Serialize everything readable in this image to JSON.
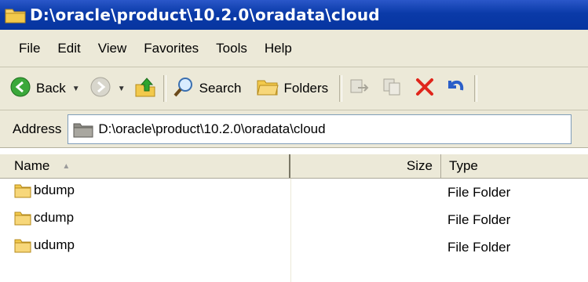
{
  "window": {
    "title": "D:\\oracle\\product\\10.2.0\\oradata\\cloud"
  },
  "menu": {
    "items": [
      {
        "label": "File"
      },
      {
        "label": "Edit"
      },
      {
        "label": "View"
      },
      {
        "label": "Favorites"
      },
      {
        "label": "Tools"
      },
      {
        "label": "Help"
      }
    ]
  },
  "toolbar": {
    "back_label": "Back",
    "search_label": "Search",
    "folders_label": "Folders"
  },
  "address": {
    "label": "Address",
    "value": "D:\\oracle\\product\\10.2.0\\oradata\\cloud"
  },
  "columns": {
    "name": "Name",
    "size": "Size",
    "type": "Type"
  },
  "files": [
    {
      "name": "bdump",
      "size": "",
      "type": "File Folder"
    },
    {
      "name": "cdump",
      "size": "",
      "type": "File Folder"
    },
    {
      "name": "udump",
      "size": "",
      "type": "File Folder"
    }
  ],
  "colors": {
    "titlebar": "#0a3aa8",
    "chrome": "#ece9d8",
    "folder": "#f2c94c"
  },
  "icons": [
    "folder-icon",
    "back-icon",
    "forward-icon",
    "up-icon",
    "search-icon",
    "folders-icon",
    "move-icon",
    "copy-icon",
    "delete-icon",
    "undo-icon"
  ]
}
